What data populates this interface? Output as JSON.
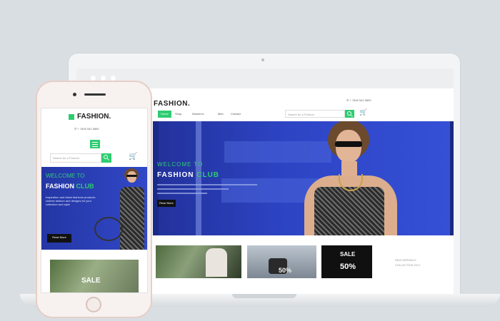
{
  "brand": {
    "name": "FASHION",
    "phone": "+ 7845 542 5890"
  },
  "nav": {
    "items": [
      "Home",
      "Shop",
      "Women's",
      "Men",
      "Contact"
    ]
  },
  "search": {
    "placeholder": "Search for a Product"
  },
  "hero": {
    "line1": "WELCOME TO",
    "line2a": "FASHION",
    "line2b": "CLUB",
    "button": "Read More",
    "phone_text": "Inspiration and latest fashions products clothes fashion and designs for your collection and style"
  },
  "promos": {
    "sale_label": "SALE",
    "sale_percent": "50%",
    "side_text_1": "NEW ARRIVALS",
    "side_text_2": "COLLECTION 2017"
  },
  "colors": {
    "accent": "#2ecc71",
    "hero_blue": "#2d44c4",
    "dark": "#111111"
  },
  "icons": {
    "cart": "cart-icon",
    "search": "search-icon",
    "phone": "phone-icon",
    "menu": "hamburger-icon"
  }
}
